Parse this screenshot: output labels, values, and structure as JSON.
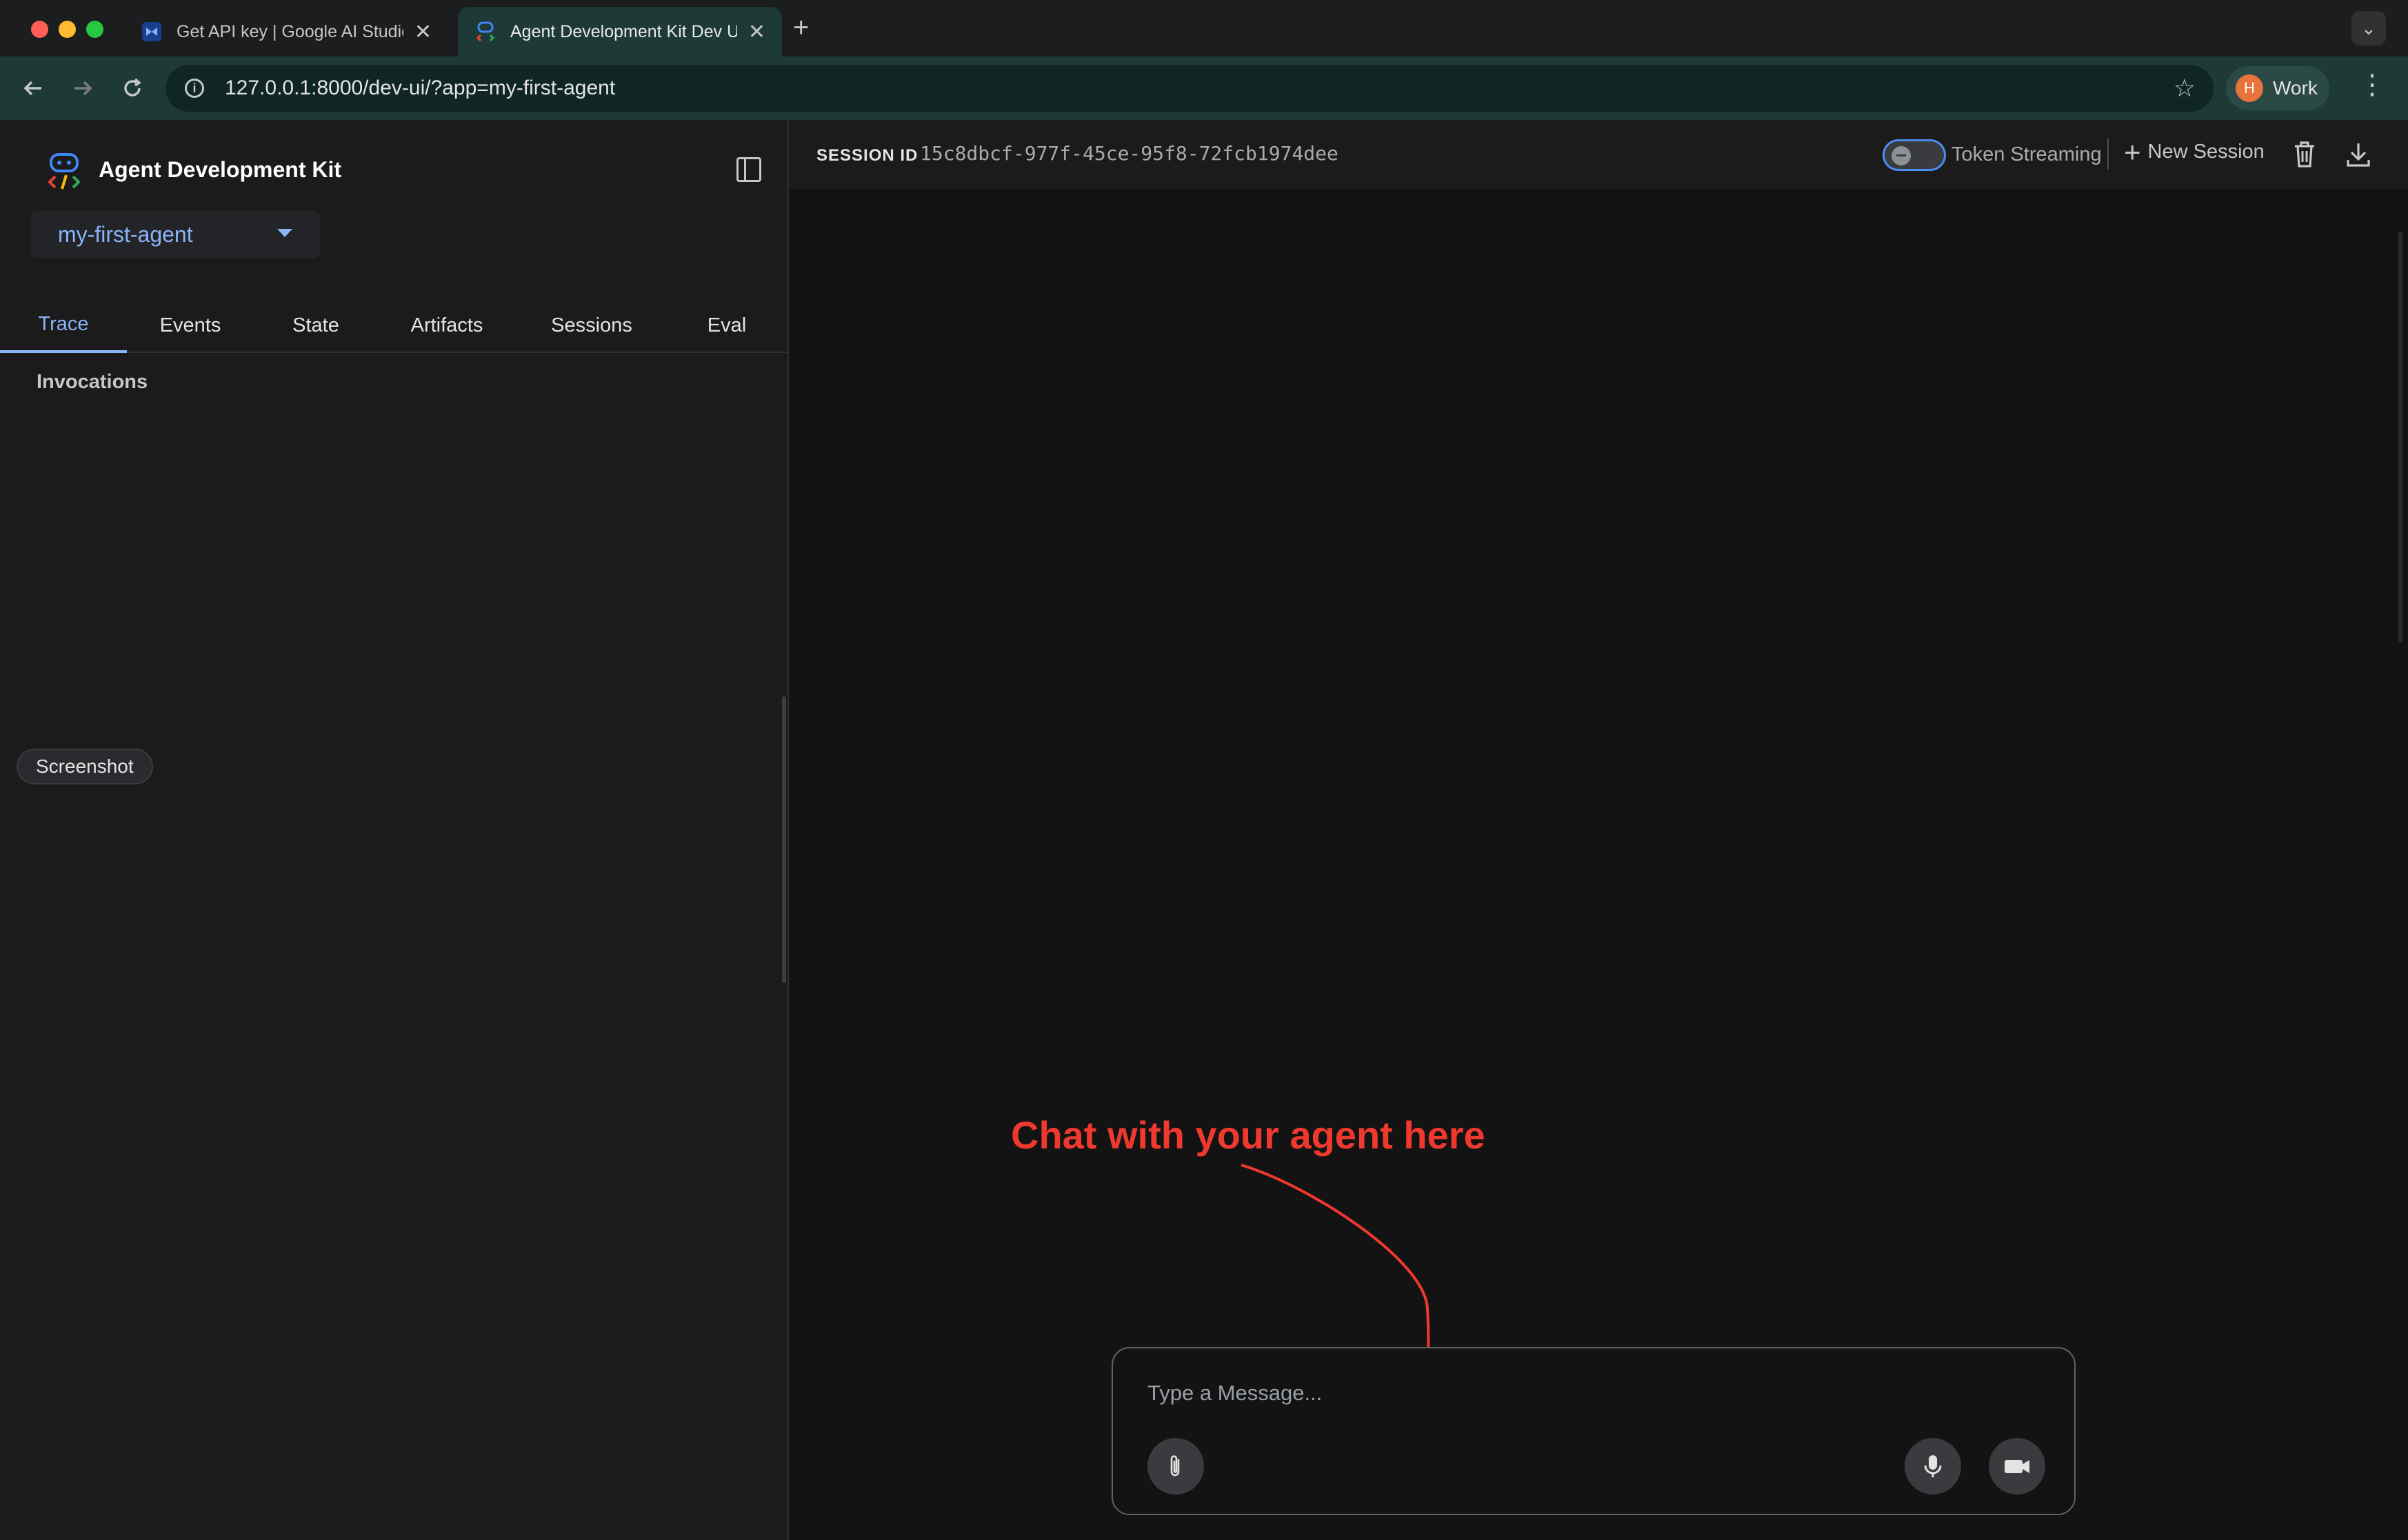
{
  "browser": {
    "tabs": [
      {
        "title": "Get API key | Google AI Studio",
        "active": false
      },
      {
        "title": "Agent Development Kit Dev UI",
        "active": true
      }
    ],
    "url": "127.0.0.1:8000/dev-ui/?app=my-first-agent",
    "profile": {
      "initial": "H",
      "label": "Work"
    }
  },
  "sidebar": {
    "app_title": "Agent Development Kit",
    "selected_agent": "my-first-agent",
    "tabs": [
      "Trace",
      "Events",
      "State",
      "Artifacts",
      "Sessions",
      "Eval"
    ],
    "active_tab": "Trace",
    "section_title": "Invocations",
    "screenshot_chip": "Screenshot"
  },
  "main": {
    "session_label": "SESSION ID",
    "session_id": "15c8dbcf-977f-45ce-95f8-72fcb1974dee",
    "token_streaming_label": "Token Streaming",
    "token_streaming_on": false,
    "new_session_label": "New Session",
    "annotation": "Chat with your agent here",
    "annotation_color": "#f0392e",
    "composer": {
      "placeholder": "Type a Message...",
      "value": ""
    }
  },
  "colors": {
    "accent": "#8ab4f8",
    "toggle_border": "#4a8cf0"
  },
  "icons": [
    "back-icon",
    "forward-icon",
    "reload-icon",
    "info-icon",
    "star-icon",
    "kebab-icon",
    "collapse-sidebar-icon",
    "dropdown-caret-icon",
    "trash-icon",
    "download-icon",
    "attach-icon",
    "mic-icon",
    "video-icon"
  ]
}
